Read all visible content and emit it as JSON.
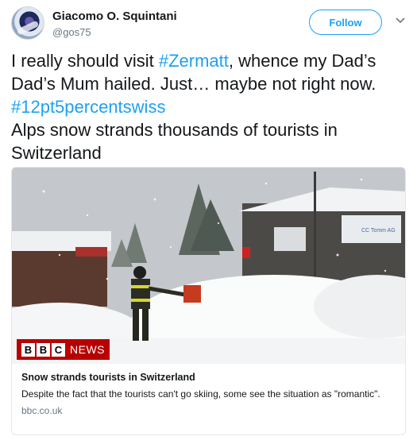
{
  "author": {
    "display_name": "Giacomo O. Squintani",
    "handle": "@gos75"
  },
  "header": {
    "follow_label": "Follow",
    "menu_icon": "chevron-down-icon"
  },
  "tweet": {
    "text_part1": "I really should visit ",
    "hashtag1": "#Zermatt",
    "text_part2": ", whence my Dad’s Dad’s Mum hailed. Just… maybe not right now. ",
    "hashtag2": "#12pt5percentswiss",
    "text_part3": "Alps snow strands thousands of tourists in Switzerland"
  },
  "card": {
    "image_description_icon": "news-photo",
    "logo": {
      "letters": [
        "B",
        "B",
        "C"
      ],
      "news_text": "NEWS"
    },
    "shop_sign": "CC Tomm AG",
    "title": "Snow strands tourists in Switzerland",
    "description": "Despite the fact that the tourists can't go skiing, some see the situation as \"romantic\".",
    "domain": "bbc.co.uk"
  },
  "colors": {
    "link": "#1da1f2",
    "text": "#14171a",
    "muted": "#657786",
    "bbc_red": "#b80000"
  }
}
